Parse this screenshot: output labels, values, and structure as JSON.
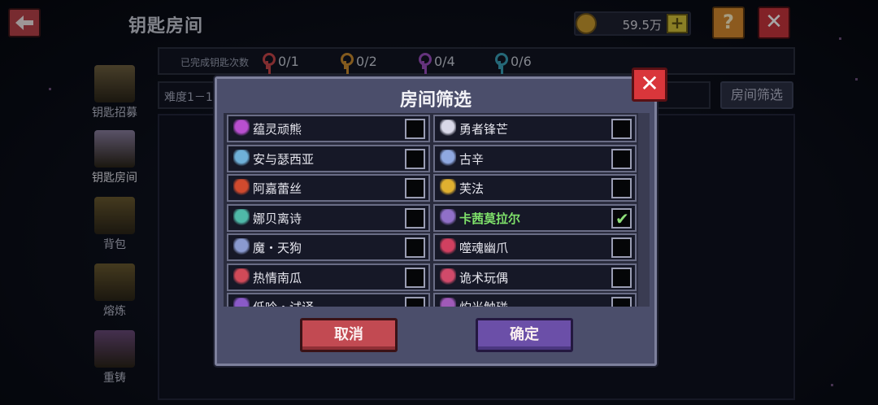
{
  "header": {
    "title": "钥匙房间",
    "coins": "59.5万",
    "help_label": "?",
    "close_label": "✕",
    "back_icon": "arrow-left-icon"
  },
  "stats": {
    "label": "已完成钥匙次数",
    "items": [
      {
        "value": "0/1",
        "key_color": "#c8454a"
      },
      {
        "value": "0/2",
        "key_color": "#c98a2e"
      },
      {
        "value": "0/4",
        "key_color": "#9b4fc0"
      },
      {
        "value": "0/6",
        "key_color": "#3aa0b8"
      }
    ]
  },
  "difficulty_label": "难度1－1",
  "room_filter_button": "房间筛选",
  "sidebar": [
    {
      "label": "钥匙招募",
      "color": "#6e6040"
    },
    {
      "label": "钥匙房间",
      "color": "#8a7fa0"
    },
    {
      "label": "背包",
      "color": "#6a5a30"
    },
    {
      "label": "熔炼",
      "color": "#6a5a30"
    },
    {
      "label": "重铸",
      "color": "#6a4a7a"
    }
  ],
  "modal": {
    "title": "房间筛选",
    "close_label": "✕",
    "cancel_label": "取消",
    "confirm_label": "确定",
    "rows": [
      {
        "left": {
          "label": "蕴灵顽熊",
          "checked": false,
          "icon_color": "#b84fcf"
        },
        "right": {
          "label": "勇者锋芒",
          "checked": false,
          "icon_color": "#d8d8e8"
        }
      },
      {
        "left": {
          "label": "安与瑟西亚",
          "checked": false,
          "icon_color": "#6fb0d8"
        },
        "right": {
          "label": "古辛",
          "checked": false,
          "icon_color": "#8fa8e0"
        }
      },
      {
        "left": {
          "label": "阿嘉蕾丝",
          "checked": false,
          "icon_color": "#d04a2e"
        },
        "right": {
          "label": "芙法",
          "checked": false,
          "icon_color": "#e0b030"
        }
      },
      {
        "left": {
          "label": "娜贝离诗",
          "checked": false,
          "icon_color": "#4fb8a8"
        },
        "right": {
          "label": "卡茜莫拉尔",
          "checked": true,
          "icon_color": "#9070c8"
        }
      },
      {
        "left": {
          "label": "魔・天狗",
          "checked": false,
          "icon_color": "#8a9ad0"
        },
        "right": {
          "label": "噬魂幽爪",
          "checked": false,
          "icon_color": "#d04060"
        }
      },
      {
        "left": {
          "label": "热情南瓜",
          "checked": false,
          "icon_color": "#d04a58"
        },
        "right": {
          "label": "诡术玩偶",
          "checked": false,
          "icon_color": "#d04a6a"
        }
      },
      {
        "left": {
          "label": "低吟・试译",
          "checked": false,
          "icon_color": "#8a5ac8"
        },
        "right": {
          "label": "灼光触碰",
          "checked": false,
          "icon_color": "#a05ab8"
        }
      }
    ]
  }
}
